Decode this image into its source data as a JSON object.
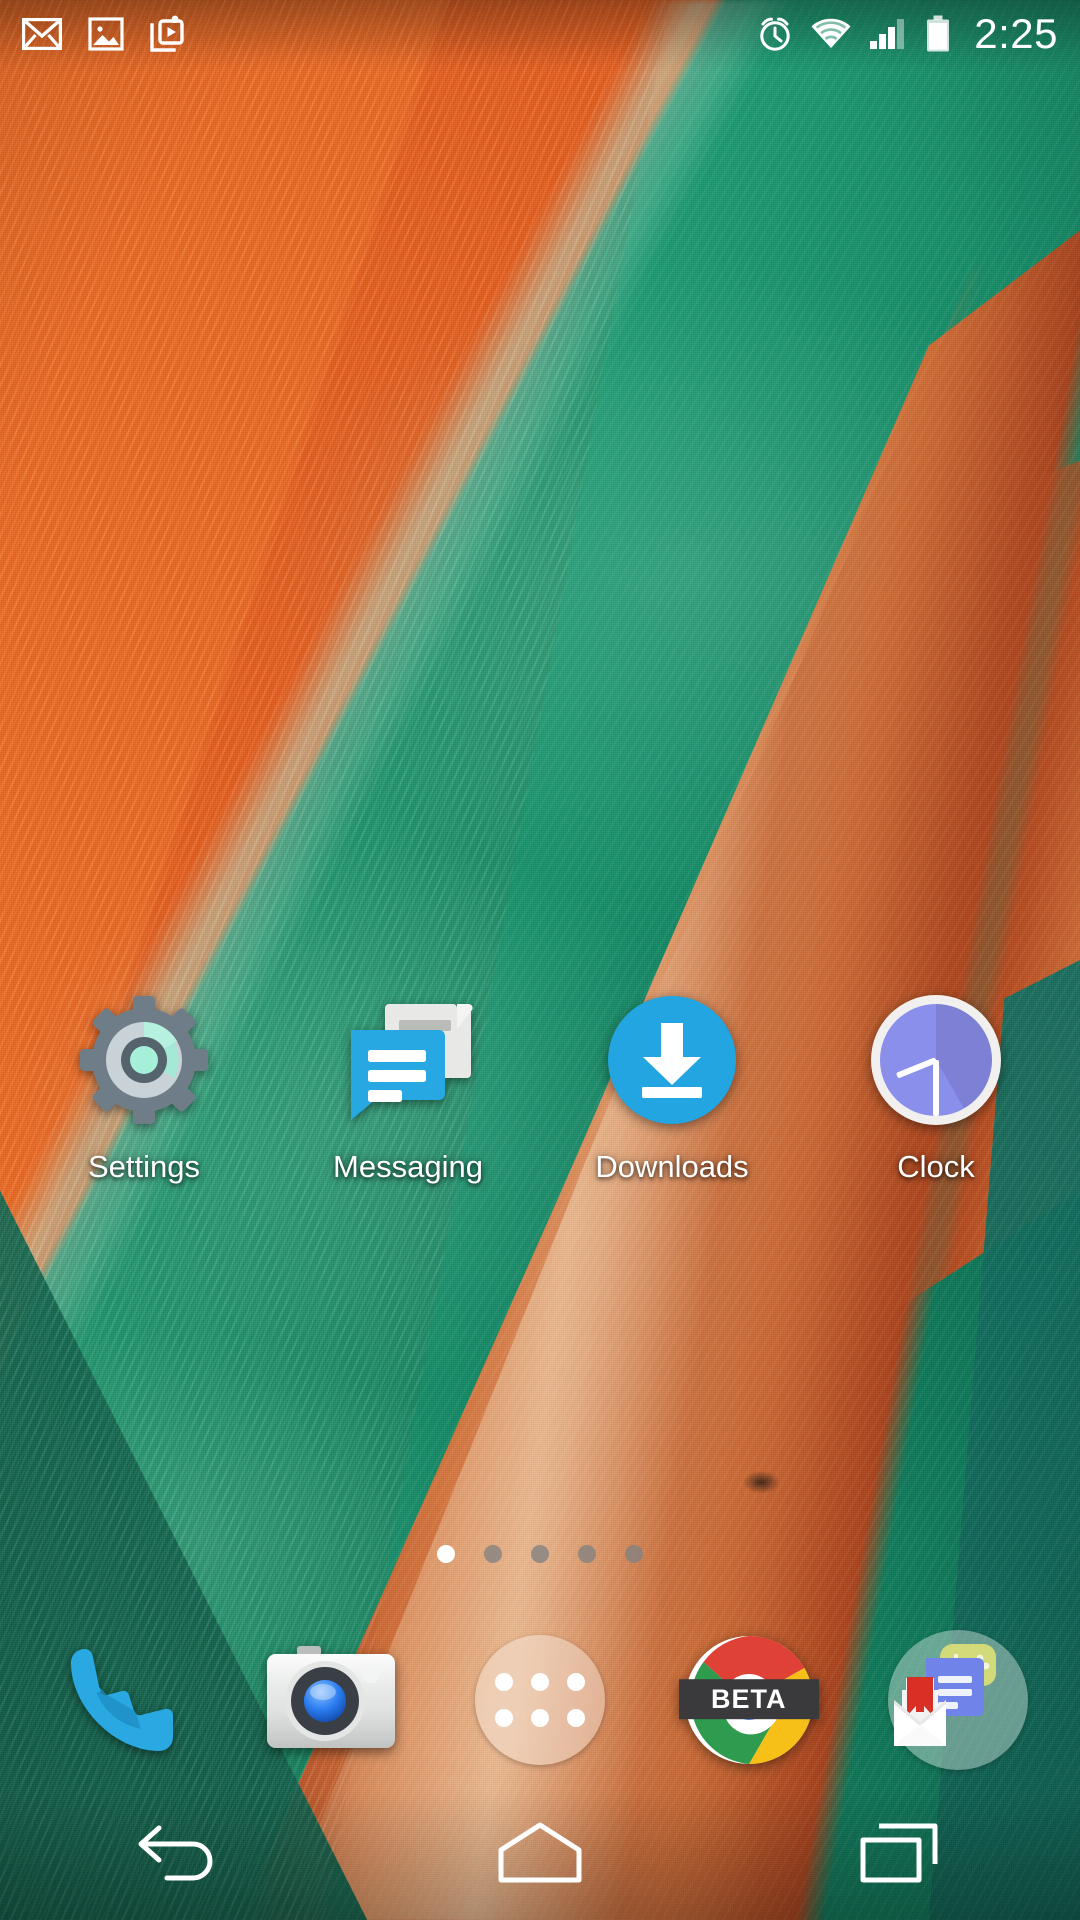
{
  "device": {
    "platform": "Android",
    "screen_type": "home-screen"
  },
  "status_bar": {
    "time": "2:25",
    "left_icons": [
      {
        "name": "gmail-notification-icon",
        "glyph": "M"
      },
      {
        "name": "screenshot-notification-icon",
        "glyph": "image"
      },
      {
        "name": "play-store-download-icon",
        "glyph": "play"
      }
    ],
    "right_icons": [
      {
        "name": "alarm-icon",
        "label": "Alarm set"
      },
      {
        "name": "wifi-icon",
        "label": "Wi-Fi connected"
      },
      {
        "name": "cellular-signal-icon",
        "label": "Signal 3 bars"
      },
      {
        "name": "battery-icon",
        "label": "Battery full"
      }
    ]
  },
  "home": {
    "apps": [
      {
        "label": "Settings",
        "icon": "settings-gear-icon",
        "color": "#6b7a85"
      },
      {
        "label": "Messaging",
        "icon": "messaging-bubble-icon",
        "color": "#29a8e0"
      },
      {
        "label": "Downloads",
        "icon": "downloads-arrow-icon",
        "color": "#22a5e0"
      },
      {
        "label": "Clock",
        "icon": "clock-face-icon",
        "color": "#8b8fec"
      }
    ],
    "page_indicator": {
      "total_pages": 5,
      "current_page": 1
    }
  },
  "dock": {
    "items": [
      {
        "label": "Phone",
        "icon": "phone-handset-icon",
        "color": "#29a8e0"
      },
      {
        "label": "Camera",
        "icon": "camera-icon",
        "color": "#d8d8d8"
      },
      {
        "label": "Apps",
        "icon": "app-drawer-icon",
        "color": "#ffffff"
      },
      {
        "label": "Chrome Beta",
        "icon": "chrome-icon",
        "badge": "BETA",
        "color": "#4285f4"
      },
      {
        "label": "Folder",
        "icon": "app-folder-icon",
        "color": "#d93025"
      }
    ]
  },
  "nav_bar": {
    "buttons": [
      {
        "label": "Back",
        "icon": "back-arrow-icon"
      },
      {
        "label": "Home",
        "icon": "home-icon"
      },
      {
        "label": "Recents",
        "icon": "recents-icon"
      }
    ]
  },
  "wallpaper": {
    "name": "satellite-desert-coast-wallpaper",
    "colors": {
      "sand": "#e8601f",
      "water": "#12866199",
      "sandbar": "#cf6c34"
    }
  }
}
